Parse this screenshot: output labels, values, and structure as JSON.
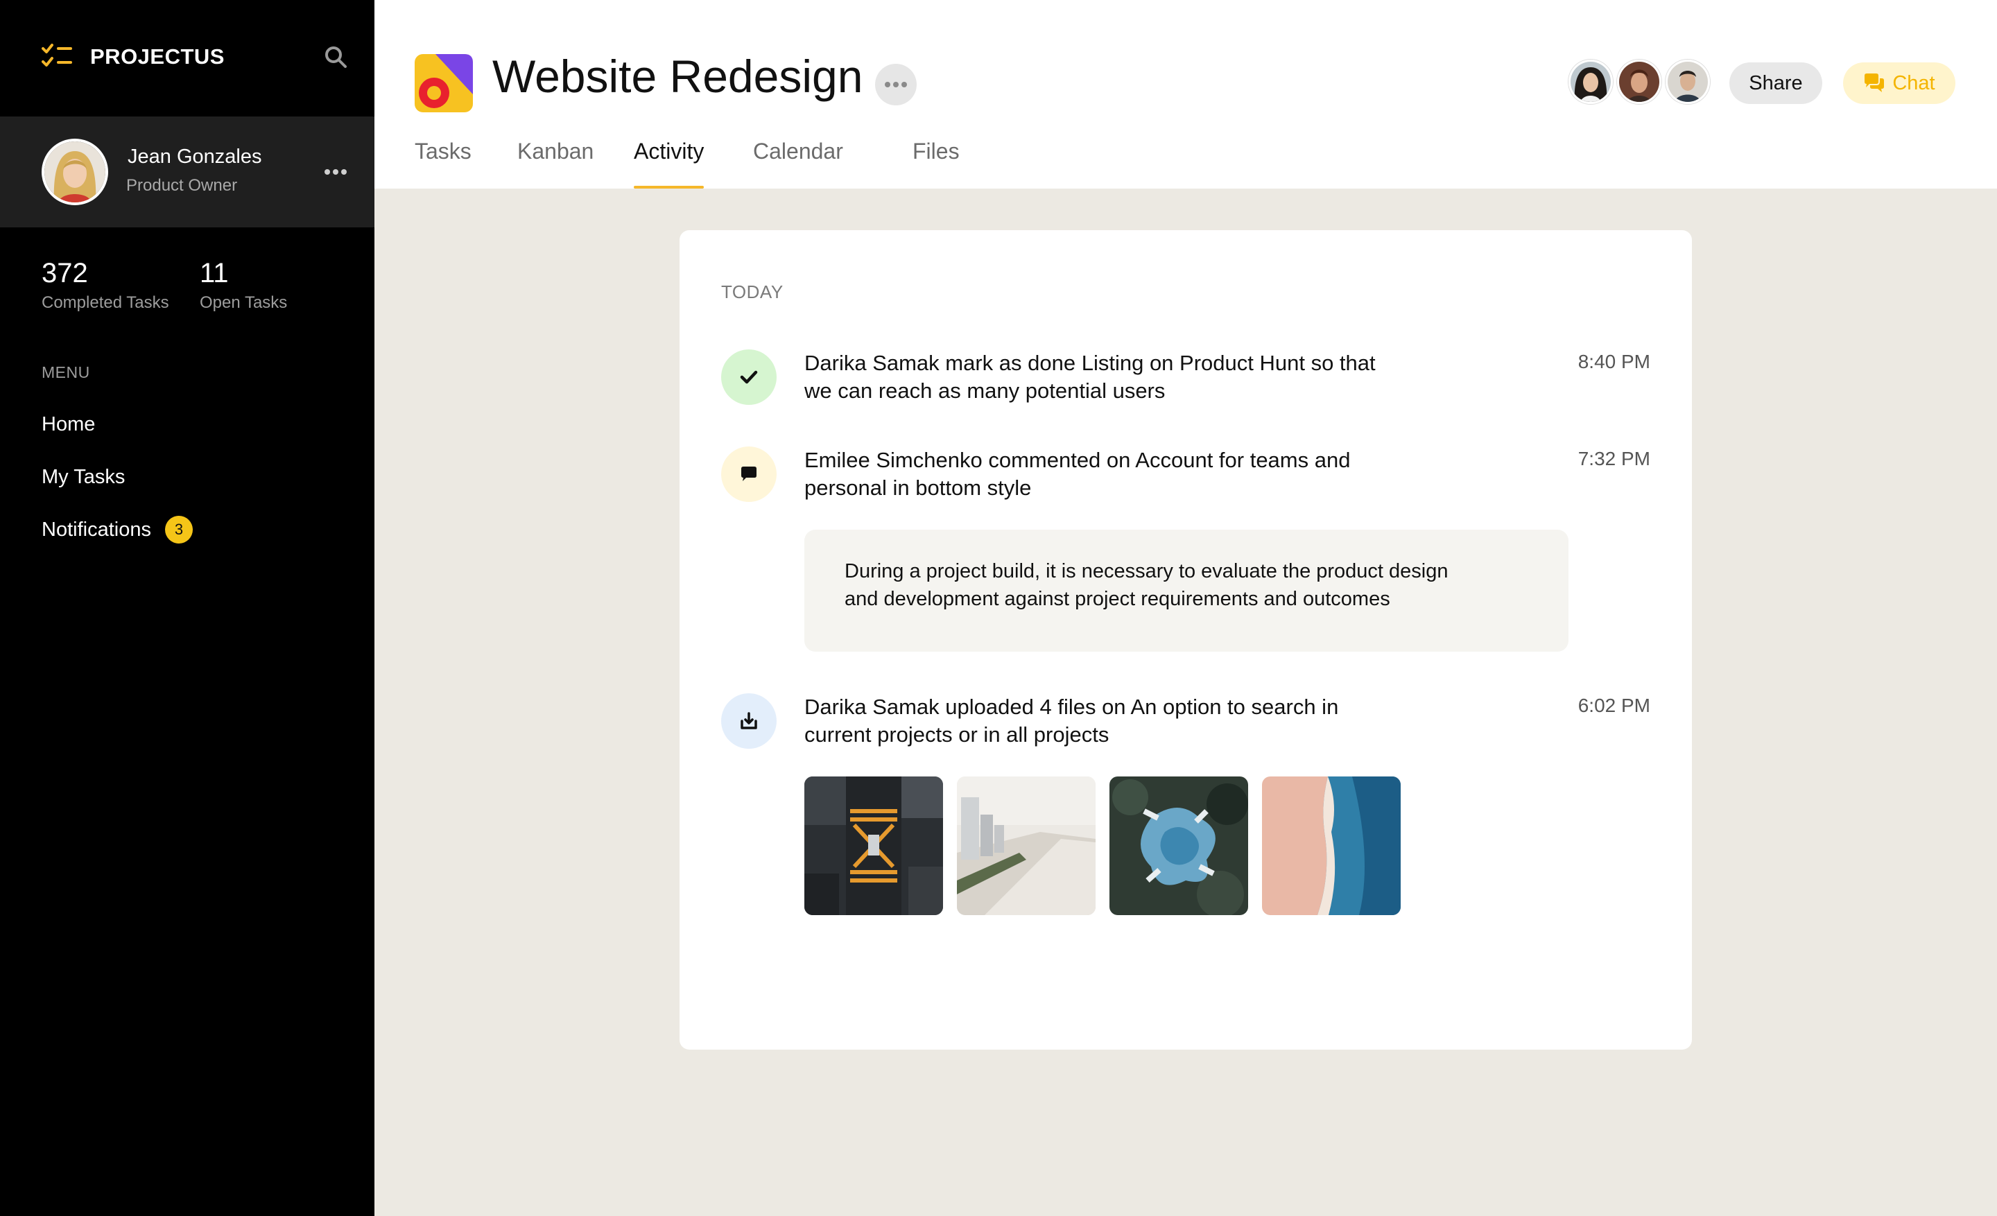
{
  "app": {
    "name": "PROJECTUS"
  },
  "user": {
    "name": "Jean Gonzales",
    "role": "Product Owner"
  },
  "stats": [
    {
      "value": "372",
      "label": "Completed Tasks"
    },
    {
      "value": "11",
      "label": "Open Tasks"
    }
  ],
  "menu": {
    "title": "MENU",
    "items": [
      {
        "label": "Home"
      },
      {
        "label": "My Tasks"
      },
      {
        "label": "Notifications",
        "badge": "3"
      }
    ]
  },
  "project": {
    "title": "Website Redesign"
  },
  "tabs": [
    {
      "label": "Tasks",
      "active": false
    },
    {
      "label": "Kanban",
      "active": false
    },
    {
      "label": "Activity",
      "active": true
    },
    {
      "label": "Calendar",
      "active": false
    },
    {
      "label": "Files",
      "active": false
    }
  ],
  "header_actions": {
    "share": "Share",
    "chat": "Chat"
  },
  "activity": {
    "day": "TODAY",
    "items": [
      {
        "icon": "check-icon",
        "text_line1": "Darika Samak mark as done Listing on Product Hunt so that",
        "text_line2": "we can reach as many potential users",
        "time": "8:40 PM"
      },
      {
        "icon": "comment-icon",
        "text_line1": "Emilee Simchenko commented on Account for teams and",
        "text_line2": "personal in bottom style",
        "time": "7:32 PM",
        "comment_line1": "During a project build, it is necessary to evaluate the product design",
        "comment_line2": "and development against project requirements and outcomes"
      },
      {
        "icon": "upload-icon",
        "text_line1": "Darika Samak uploaded 4 files on An option to search in",
        "text_line2": "current projects or in all projects",
        "time": "6:02 PM"
      }
    ]
  },
  "colors": {
    "accent": "#f5b72a",
    "badge": "#f5c518",
    "sidebar_bg": "#000000",
    "profile_bg": "#1f1f1f",
    "page_bg": "#ece9e2",
    "check_bg": "#d6f5d0",
    "comment_bg": "#fff6d9",
    "upload_bg": "#e3eefb"
  }
}
